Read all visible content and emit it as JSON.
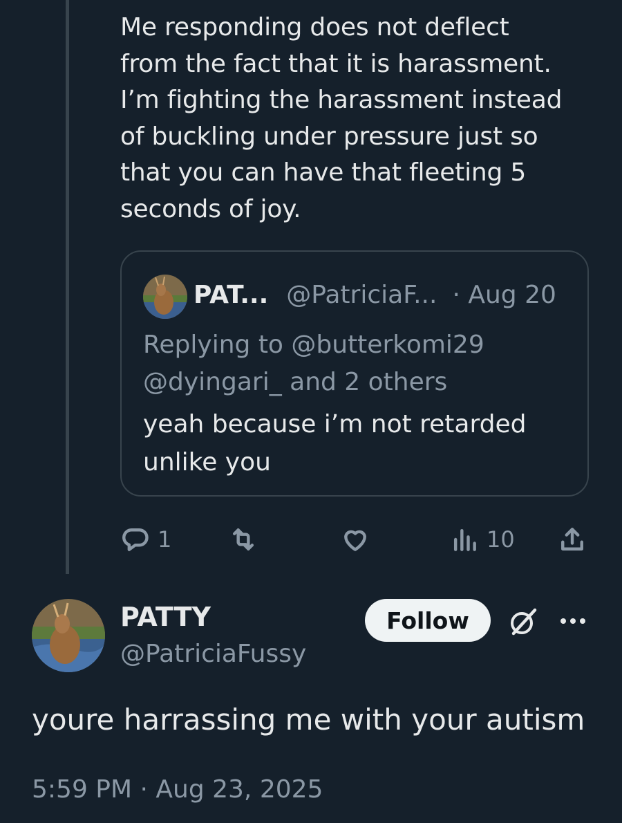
{
  "parent_tweet": {
    "text": "Me responding does not deflect\nfrom the fact that it is harassment.\nI’m fighting the harassment instead\nof buckling under pressure just so\nthat you can have that fleeting 5\nseconds of joy."
  },
  "quoted_tweet": {
    "name": "PAT...",
    "handle": "@PatriciaF...",
    "date": "· Aug 20",
    "replying_line1": "Replying to @butterkomi29",
    "replying_line2": "@dyingari_ and 2 others",
    "text": "yeah because i’m not retarded\nunlike you"
  },
  "actions": {
    "reply_count": "1",
    "retweet_count": "",
    "like_count": "",
    "views_count": "10"
  },
  "main_tweet": {
    "name": "PATTY",
    "handle": "@PatriciaFussy",
    "follow_label": "Follow",
    "text": "youre harrassing me with your autism",
    "timestamp": "5:59 PM · Aug 23, 2025"
  },
  "icons": {
    "reply": "reply-icon",
    "retweet": "retweet-icon",
    "like": "heart-icon",
    "views": "views-icon",
    "share": "share-icon",
    "grok": "grok-icon",
    "more": "more-icon"
  },
  "colors": {
    "background": "#15202b",
    "text_primary": "#e7e9ea",
    "text_secondary": "#8b98a5",
    "border": "#38444d",
    "follow_bg": "#eff3f4"
  }
}
